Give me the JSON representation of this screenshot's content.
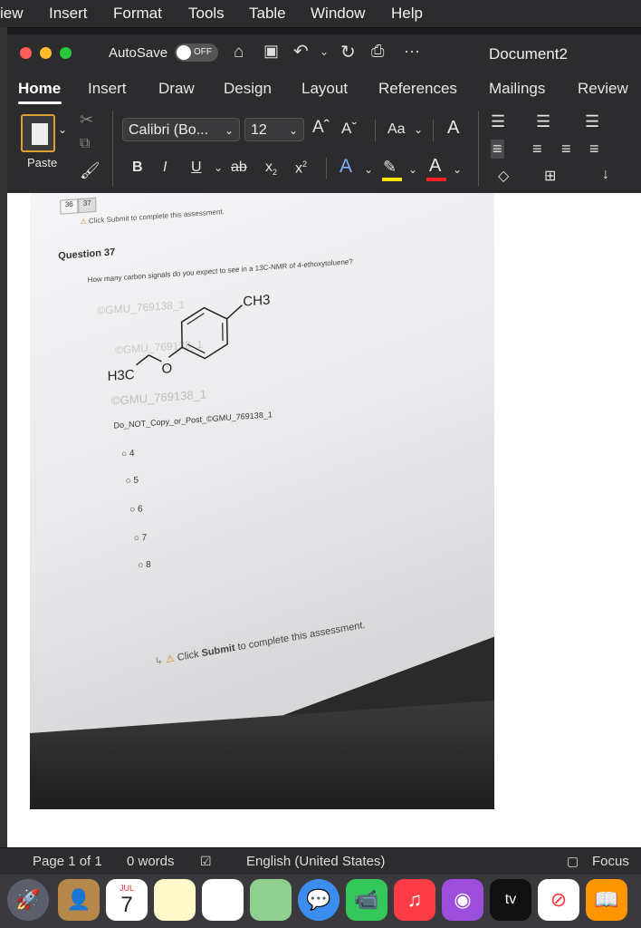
{
  "menubar": {
    "items": [
      "iew",
      "Insert",
      "Format",
      "Tools",
      "Table",
      "Window",
      "Help"
    ]
  },
  "titlebar": {
    "autosave_label": "AutoSave",
    "autosave_state": "OFF",
    "doc_title": "Document2",
    "more": "···"
  },
  "ribbon_tabs": [
    "Home",
    "Insert",
    "Draw",
    "Design",
    "Layout",
    "References",
    "Mailings",
    "Review"
  ],
  "ribbon": {
    "paste_label": "Paste",
    "font_name": "Calibri (Bo...",
    "font_size": "12",
    "grow_font": "Aˆ",
    "shrink_font": "Aˇ",
    "change_case": "Aa",
    "bold": "B",
    "italic": "I",
    "underline": "U",
    "strike": "ab",
    "subscript": "x",
    "superscript": "x"
  },
  "document": {
    "tab_numbers": [
      "36",
      "37"
    ],
    "top_notice": "Click Submit to complete this assessment.",
    "question_title": "Question 37",
    "question_text": "How many carbon signals do you expect to see in a 13C-NMR of 4-ethoxytoluene?",
    "watermark1": "©GMU_769138_1",
    "watermark2": "©GMU_769138_1",
    "watermark3": "©GMU_769138_1",
    "ch3_label": "CH3",
    "h3c_label": "H3C",
    "o_label": "O",
    "copy_notice": "Do_NOT_Copy_or_Post_©GMU_769138_1",
    "options": [
      "4",
      "5",
      "6",
      "7",
      "8"
    ],
    "bottom_notice_pre": "Click ",
    "bottom_notice_bold": "Submit",
    "bottom_notice_post": " to complete this assessment."
  },
  "statusbar": {
    "page": "Page 1 of 1",
    "words": "0 words",
    "language": "English (United States)",
    "focus": "Focus"
  },
  "dock": {
    "calendar_month": "JUL",
    "calendar_day": "7",
    "tv_label": "tv"
  },
  "colors": {
    "accent_blue": "#1a73e8",
    "red": "#ff5f57",
    "yellow": "#febc2e",
    "green": "#28c840"
  }
}
